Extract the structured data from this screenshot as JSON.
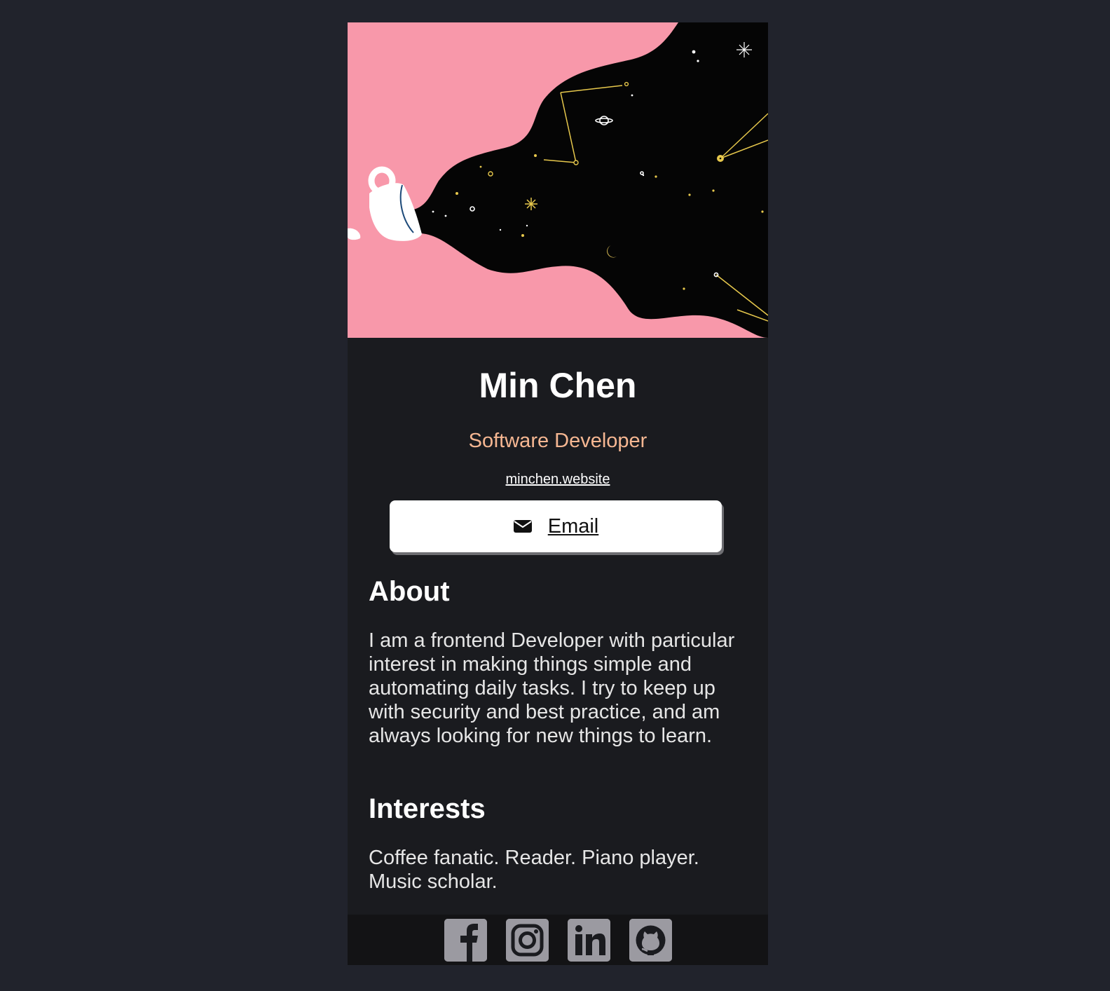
{
  "profile": {
    "name": "Min Chen",
    "role": "Software Developer",
    "website": "minchen.website",
    "email_label": "Email",
    "hero_icon": "cup-pouring-galaxy-illustration"
  },
  "about": {
    "title": "About",
    "text": "I am a frontend Developer with particular interest in making things simple and automating daily tasks. I try to keep up with security and best practice, and am always looking for new things to learn."
  },
  "interests": {
    "title": "Interests",
    "text": "Coffee fanatic. Reader. Piano player. Music scholar."
  },
  "footer": {
    "social_icons": [
      "facebook-icon",
      "instagram-icon",
      "linkedin-icon",
      "github-icon"
    ]
  },
  "colors": {
    "page_background": "#21232c",
    "card_background": "#1a1b1f",
    "hero_pink": "#f898aa",
    "accent_orange": "#f6b792",
    "footer_background": "#131315",
    "social_icon_bg": "#9b9aa1"
  }
}
